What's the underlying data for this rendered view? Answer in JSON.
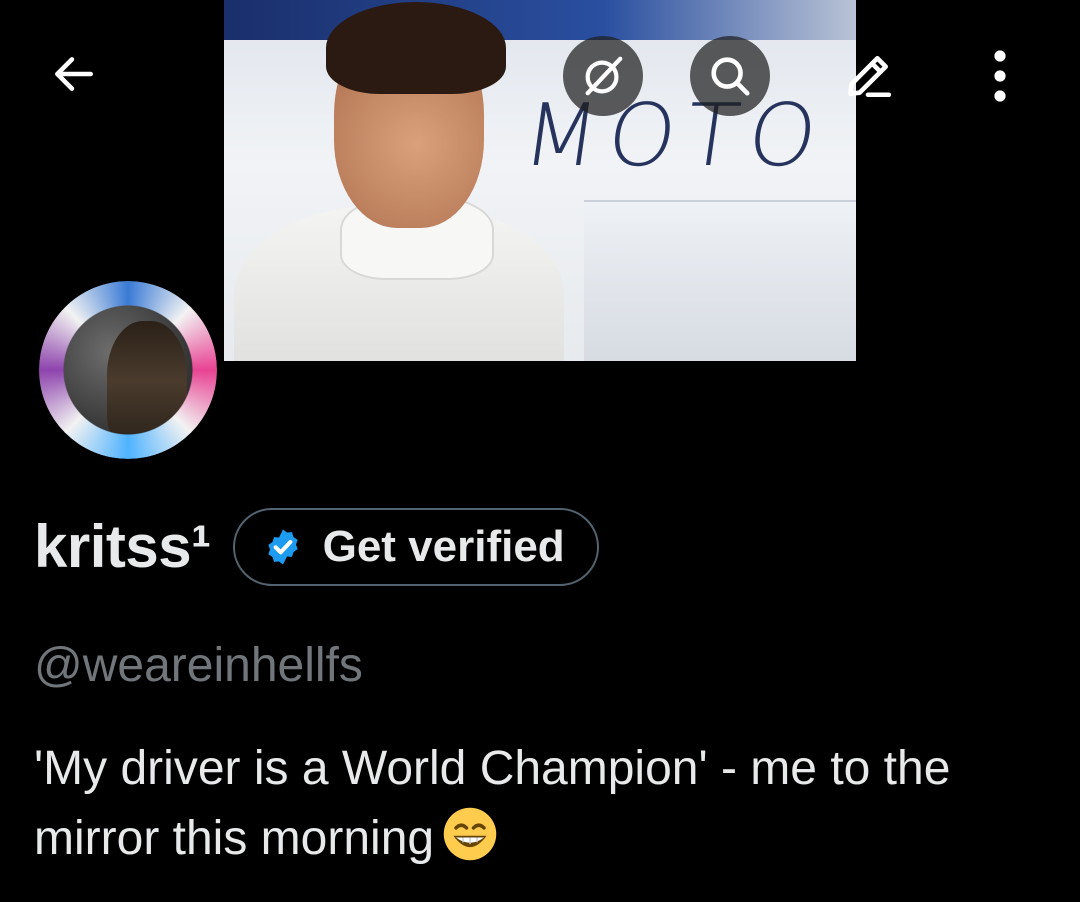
{
  "header": {
    "back_icon": "arrow-left-icon",
    "grok_icon": "grok-slash-circle-icon",
    "search_icon": "search-icon",
    "edit_icon": "pencil-icon",
    "more_icon": "vertical-dots-icon"
  },
  "banner": {
    "text": "MOTO"
  },
  "profile": {
    "display_name": "kritss¹",
    "verify_button": "Get verified",
    "handle": "@weareinhellfs",
    "bio": "'My driver is a World Champion' - me to the mirror this morning",
    "bio_emoji": "grinning-face-emoji"
  },
  "colors": {
    "background": "#000000",
    "text_primary": "#e7e9ea",
    "text_secondary": "#71767b",
    "verified_blue": "#1d9bf0",
    "pill_border": "#536471"
  }
}
